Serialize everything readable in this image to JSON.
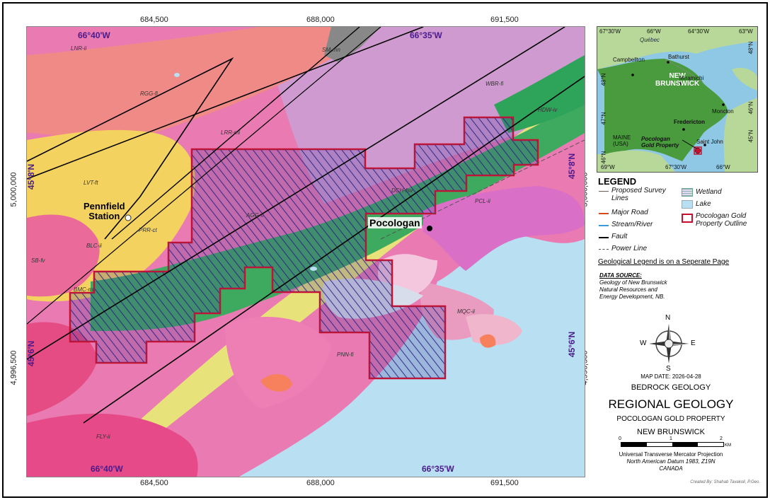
{
  "map": {
    "easting_ticks": [
      "684,500",
      "688,000",
      "691,500"
    ],
    "northing_ticks": [
      "5,000,000",
      "4,996,500"
    ],
    "longitudes": [
      "66°40'W",
      "66°35'W"
    ],
    "latitudes": [
      "45°8'N",
      "45°6'N"
    ],
    "unit_labels": [
      "LNR-ii",
      "SM-mn",
      "RGG-fi",
      "WBR-fi",
      "HDW-iv",
      "LRR-mi",
      "LVT-ft",
      "PRR-ct",
      "BLC-ii",
      "SB-fv",
      "BMC-mi",
      "PCL-ii",
      "MQC-ii",
      "PNN-fi",
      "FLY-ii",
      "DCH-fsv",
      "AGG-fi"
    ],
    "places": {
      "pennfield": "Pennfield\nStation",
      "pocologan": "Pocologan"
    }
  },
  "inset": {
    "top_ticks": [
      "67°30'W",
      "66°W",
      "64°30'W",
      "63°W"
    ],
    "bottom_ticks": [
      "69°W",
      "67°30'W",
      "66°W"
    ],
    "left_ticks": [
      "48°N",
      "47°N",
      "46°N"
    ],
    "right_ticks": [
      "48°N",
      "46°N",
      "45°N"
    ],
    "quebec": "Québec",
    "province": "NEW\nBRUNSWICK",
    "cities": [
      "Campbellton",
      "Bathurst",
      "Miramichi",
      "Moncton",
      "Fredericton",
      "Saint John"
    ],
    "maine": "MAINE\n(USA)",
    "property": "Pocologan\nGold Property"
  },
  "legend": {
    "title": "LEGEND",
    "items": [
      {
        "label": "Proposed Survey\nLines",
        "color": "#7a5a4a"
      },
      {
        "label": "Major Road",
        "color": "#d84a1a"
      },
      {
        "label": "Stream/River",
        "color": "#3a9ad8"
      },
      {
        "label": "Fault",
        "color": "#000000"
      },
      {
        "label": "Power Line",
        "color": "#555555"
      }
    ],
    "items2": [
      {
        "label": "Wetland"
      },
      {
        "label": "Lake"
      },
      {
        "label": "Pocologan Gold\nProperty Outline"
      }
    ],
    "note": "Geological Legend is on a Seperate Page",
    "source_title": "DATA SOURCE:",
    "source_text": "Geology of New Brunswick\nNatural Resources and\nEnergy Development, NB."
  },
  "compass": {
    "n": "N",
    "s": "S",
    "e": "E",
    "w": "W"
  },
  "titleblock": {
    "map_date": "MAP DATE: 2026-04-28",
    "subtitle": "BEDROCK GEOLOGY",
    "title": "REGIONAL GEOLOGY",
    "property": "POCOLOGAN GOLD PROPERTY",
    "province": "NEW BRUNSWICK",
    "scale_ticks": [
      "0",
      "1",
      "2"
    ],
    "scale_unit": "KM",
    "projection": "Universal Transverse Mercator Projection",
    "datum": "North American Datum 1983, Z19N",
    "country": "CANADA",
    "credit": "Created By: Shahab Tavakoli, P.Geo."
  }
}
